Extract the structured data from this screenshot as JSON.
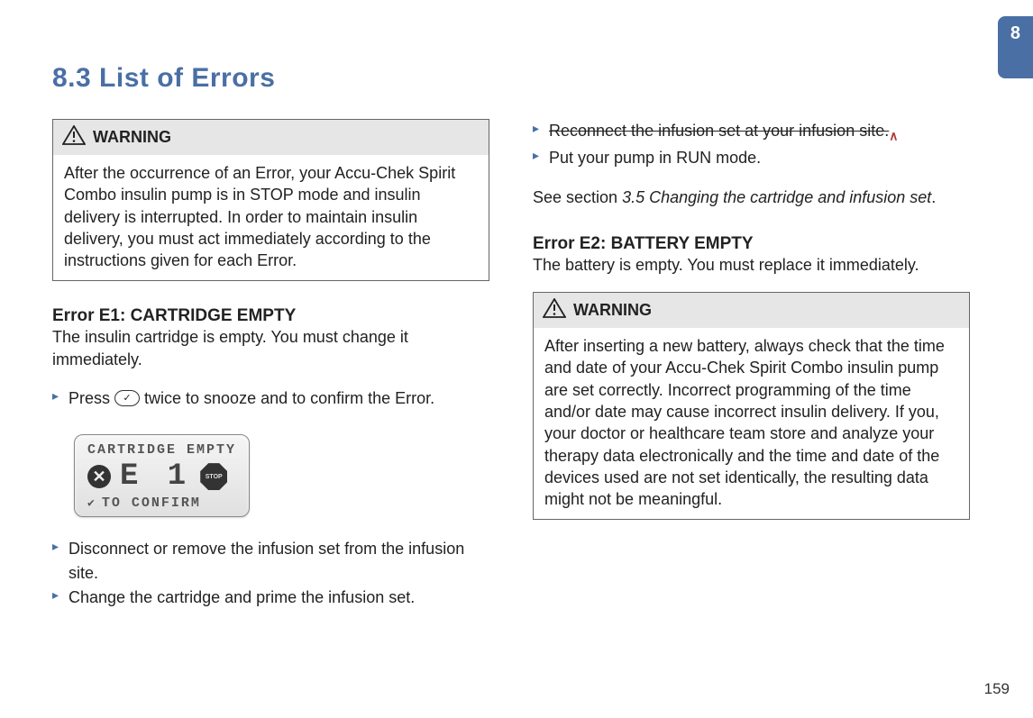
{
  "chapter_tab": "8",
  "section_title": "8.3   List of Errors",
  "page_number": "159",
  "left": {
    "warning_label": "WARNING",
    "warning_body": "After the occurrence of an Error, your Accu-Chek Spirit Combo insulin pump is in STOP mode and insulin delivery is interrupted. In order to maintain insulin delivery, you must act immediately according to the instructions given for each Error.",
    "error1_title": "Error E1: CARTRIDGE EMPTY",
    "error1_desc": "The insulin cartridge is empty. You must change it immediately.",
    "step_press_prefix": "Press ",
    "step_press_suffix": " twice to snooze and to confirm the Error.",
    "lcd": {
      "line1": "CARTRIDGE EMPTY",
      "code": "E 1",
      "stop": "STOP",
      "line3": "TO CONFIRM"
    },
    "step_disconnect": "Disconnect or remove the infusion set from the infusion site.",
    "step_change": "Change the cartridge and prime the infusion set."
  },
  "right": {
    "step_reconnect": "Reconnect the infusion set at your infusion site.",
    "edit_mark": "∧",
    "step_run": "Put your pump in RUN mode.",
    "see_prefix": "See section ",
    "see_ref": "3.5 Changing the cartridge and infusion set",
    "see_suffix": ".",
    "error2_title": "Error E2: BATTERY EMPTY",
    "error2_desc": "The battery is empty. You must replace it immediately.",
    "warning_label": "WARNING",
    "warning_body": "After inserting a new battery, always check that the time and date of your Accu-Chek Spirit Combo insulin pump are set correctly. Incorrect programming of the time and/or date may cause incorrect insulin delivery. If you, your doctor or healthcare team store and analyze your therapy data electronically and the time and date of the devices used are not set identically, the resulting data might not be meaningful."
  }
}
